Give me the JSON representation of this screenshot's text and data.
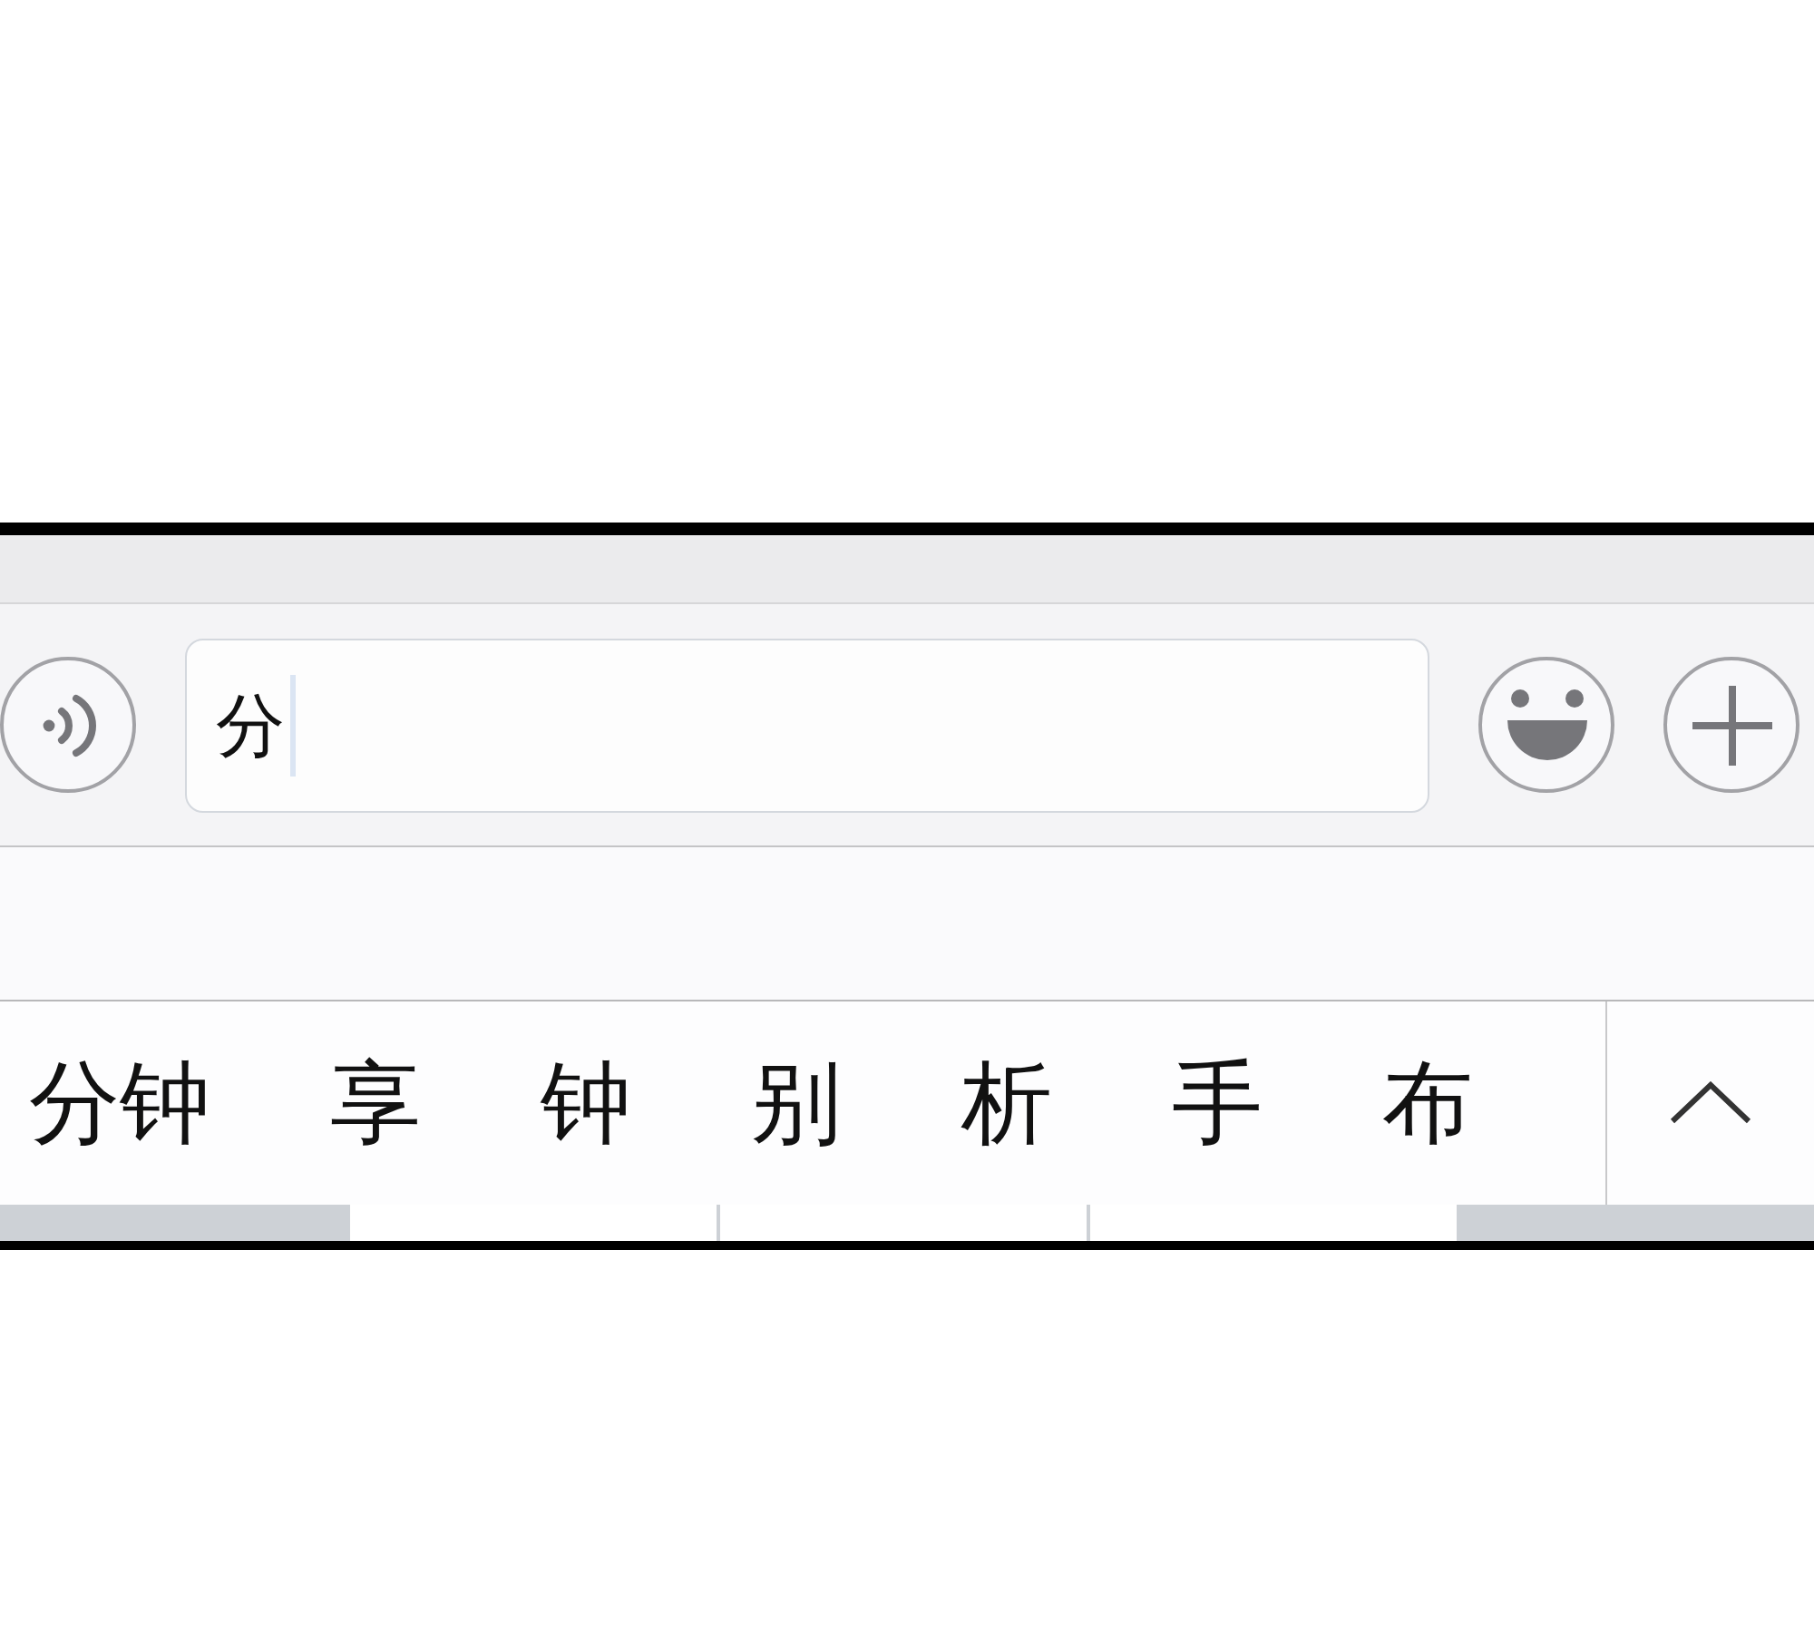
{
  "input_bar": {
    "value": "分",
    "focused": true
  },
  "candidates": [
    {
      "text": "分钟"
    },
    {
      "text": "享"
    },
    {
      "text": "钟"
    },
    {
      "text": "别"
    },
    {
      "text": "析"
    },
    {
      "text": "手"
    },
    {
      "text": "布"
    }
  ]
}
